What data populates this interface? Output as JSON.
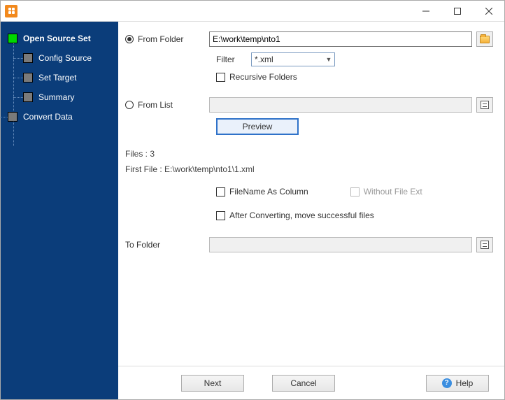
{
  "window": {
    "title": ""
  },
  "sidebar": {
    "items": [
      {
        "label": "Open Source Set"
      },
      {
        "label": "Config Source"
      },
      {
        "label": "Set Target"
      },
      {
        "label": "Summary"
      },
      {
        "label": "Convert Data"
      }
    ]
  },
  "form": {
    "from_folder_label": "From Folder",
    "from_folder_value": "E:\\work\\temp\\nto1",
    "filter_label": "Filter",
    "filter_value": "*.xml",
    "recursive_label": "Recursive Folders",
    "from_list_label": "From List",
    "from_list_value": "",
    "preview_label": "Preview",
    "files_count_label": "Files : 3",
    "first_file_label": "First File : E:\\work\\temp\\nto1\\1.xml",
    "filename_as_column_label": "FileName As Column",
    "without_ext_label": "Without File Ext",
    "after_convert_label": "After Converting, move successful files",
    "to_folder_label": "To Folder",
    "to_folder_value": ""
  },
  "footer": {
    "next": "Next",
    "cancel": "Cancel",
    "help": "Help"
  }
}
